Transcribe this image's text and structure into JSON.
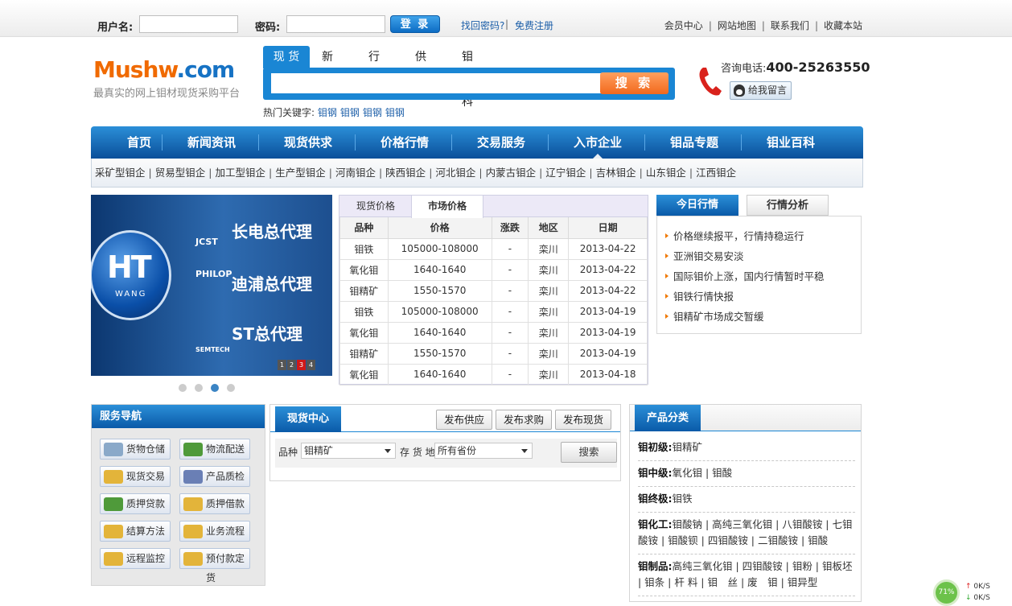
{
  "topbar": {
    "username_label": "用户名:",
    "password_label": "密码:",
    "login_label": "登 录",
    "forgot_link": "找回密码?",
    "register_link": "免费注册",
    "right_links": [
      "会员中心",
      "网站地图",
      "联系我们",
      "收藏本站"
    ]
  },
  "logo": {
    "part1": "Mushw",
    "part2": ".com",
    "slogan": "最真实的网上钼材现货采购平台"
  },
  "search": {
    "tabs": [
      "现 货",
      "新闻",
      "行情",
      "供求",
      "钼百科"
    ],
    "button_label": "搜 索",
    "hot_label": "热门关键字:",
    "hot_keywords": [
      "钼钢",
      "钼钢",
      "钼钢",
      "钼钢"
    ]
  },
  "contact": {
    "label": "咨询电话:",
    "phone": "400-25263550",
    "message_button": "给我留言"
  },
  "mainnav": [
    "首页",
    "新闻资讯",
    "现货供求",
    "价格行情",
    "交易服务",
    "入市企业",
    "钼品专题",
    "钼业百科"
  ],
  "subnav": [
    "采矿型钼企",
    "贸易型钼企",
    "加工型钼企",
    "生产型钼企",
    "河南钼企",
    "陕西钼企",
    "河北钼企",
    "内蒙古钼企",
    "辽宁钼企",
    "吉林钼企",
    "山东钼企",
    "江西钼企"
  ],
  "banner": {
    "ht": "HT",
    "ht_sub": "WANG",
    "lines": [
      "长电总代理",
      "迪浦总代理",
      "ST总代理"
    ],
    "logos": [
      "JCST",
      "PHILOP",
      "SEMTECH"
    ],
    "numbers": [
      "1",
      "2",
      "3",
      "4"
    ]
  },
  "market": {
    "tabs": [
      "现货价格",
      "市场价格"
    ],
    "headers": [
      "品种",
      "价格",
      "涨跌",
      "地区",
      "日期"
    ],
    "rows": [
      [
        "钼铁",
        "105000-108000",
        "-",
        "栾川",
        "2013-04-22"
      ],
      [
        "氧化钼",
        "1640-1640",
        "-",
        "栾川",
        "2013-04-22"
      ],
      [
        "钼精矿",
        "1550-1570",
        "-",
        "栾川",
        "2013-04-22"
      ],
      [
        "钼铁",
        "105000-108000",
        "-",
        "栾川",
        "2013-04-19"
      ],
      [
        "氧化钼",
        "1640-1640",
        "-",
        "栾川",
        "2013-04-19"
      ],
      [
        "钼精矿",
        "1550-1570",
        "-",
        "栾川",
        "2013-04-19"
      ],
      [
        "氧化钼",
        "1640-1640",
        "-",
        "栾川",
        "2013-04-18"
      ]
    ]
  },
  "news": {
    "tabs": [
      "今日行情",
      "行情分析"
    ],
    "items": [
      "价格继续报平，行情持稳运行",
      "亚洲钼交易安淡",
      "国际钼价上涨，国内行情暂时平稳",
      "钼铁行情快报",
      "钼精矿市场成交暂缓"
    ]
  },
  "service": {
    "title": "服务导航",
    "items": [
      "货物仓储",
      "物流配送",
      "现货交易",
      "产品质检",
      "质押贷款",
      "质押借款",
      "结算方法",
      "业务流程",
      "远程监控",
      "预付款定货"
    ]
  },
  "stock": {
    "title": "现货中心",
    "buttons": [
      "发布供应",
      "发布求购",
      "发布现货"
    ],
    "variety_label": "品种",
    "variety_value": "钼精矿",
    "location_label": "存 货 地",
    "location_value": "所有省份",
    "search_label": "搜索"
  },
  "category": {
    "title": "产品分类",
    "rows": [
      {
        "label": "钼初级",
        "items": "钼精矿"
      },
      {
        "label": "钼中级",
        "items": "氧化钼 | 钼酸"
      },
      {
        "label": "钼终极",
        "items": "钼铁"
      },
      {
        "label": "钼化工",
        "items": "钼酸钠 | 高纯三氧化钼 | 八钼酸铵 | 七钼酸铵 | 钼酸钡 | 四钼酸铵 | 二钼酸铵 | 钼酸"
      },
      {
        "label": "钼制品",
        "items": "高纯三氧化钼 | 四钼酸铵 | 钼粉 | 钼板坯 | 钼条 | 杆 料 | 钼　丝 | 废　钼 | 钼异型"
      }
    ]
  },
  "netmonitor": {
    "percent": "71%",
    "up": "0K/S",
    "down": "0K/S"
  }
}
